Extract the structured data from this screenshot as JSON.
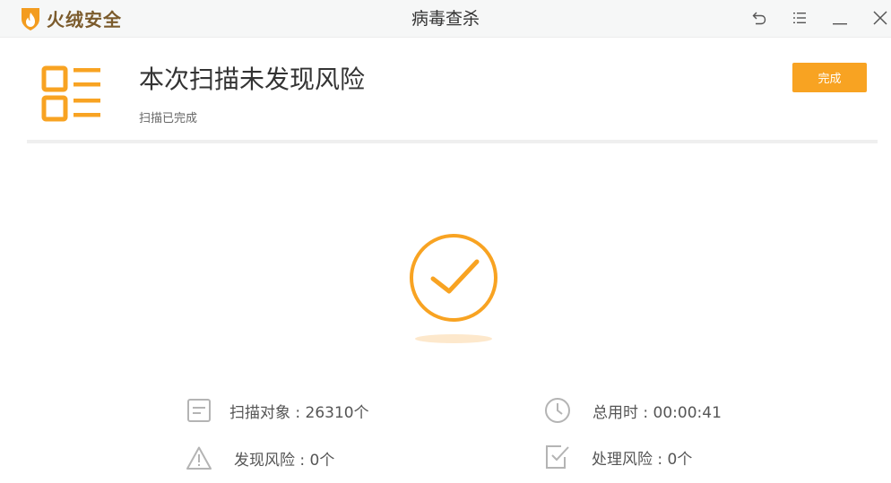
{
  "app": {
    "brand": "火绒安全",
    "window_title": "病毒查杀"
  },
  "window_controls": [
    "back-icon",
    "menu-icon",
    "minimize-icon",
    "close-icon"
  ],
  "result": {
    "title": "本次扫描未发现风险",
    "subtitle": "扫描已完成",
    "done_button": "完成"
  },
  "stats": {
    "scan_objects": "扫描对象 : 26310个",
    "total_time": "总用时 : 00:00:41",
    "risks_found": "发现风险 : 0个",
    "risks_handled": "处理风险 : 0个"
  },
  "colors": {
    "accent": "#f8a322",
    "brand_text": "#7b5b2c",
    "icon_gray": "#b4b4b4"
  }
}
